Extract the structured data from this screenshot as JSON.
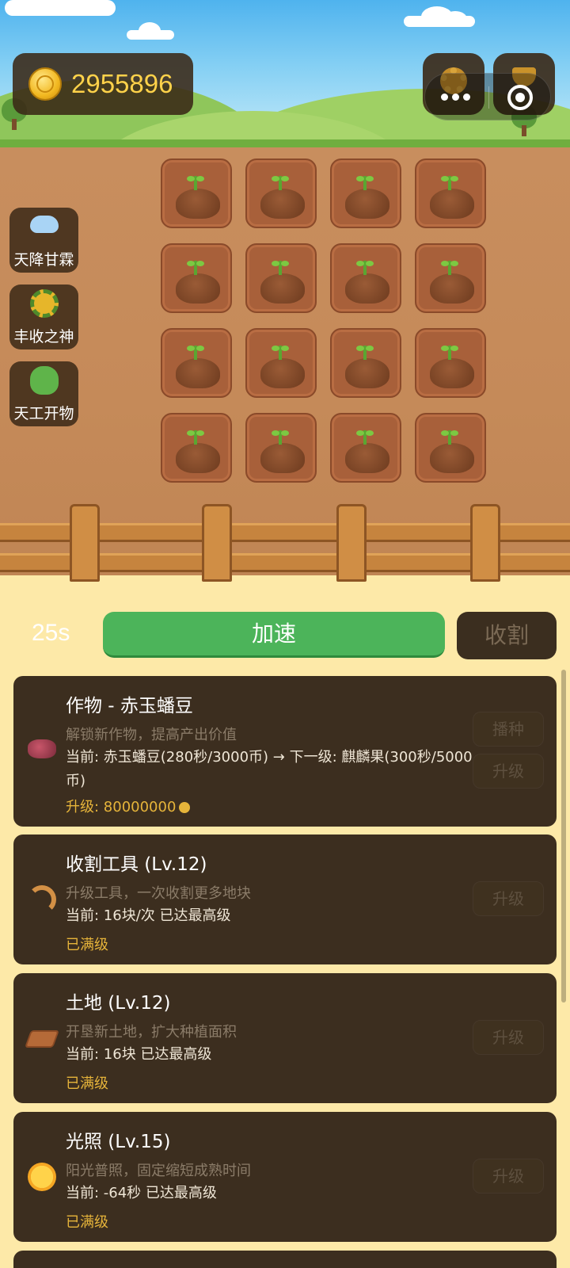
{
  "coins": {
    "value": "2955896"
  },
  "skills": [
    {
      "label": "天降甘霖",
      "icon": "rain-cloud-icon"
    },
    {
      "label": "丰收之神",
      "icon": "wreath-icon"
    },
    {
      "label": "天工开物",
      "icon": "frog-icon"
    }
  ],
  "plots": {
    "count": 16,
    "crop": "sprout"
  },
  "actions": {
    "timer": "25s",
    "speed_label": "加速",
    "harvest_label": "收割"
  },
  "cards": [
    {
      "title": "作物 - 赤玉蟠豆",
      "desc": "解锁新作物，提高产出价值",
      "current": "当前: 赤玉蟠豆(280秒/3000币) → 下一级: 麒麟果(300秒/5000币)",
      "cost": "升级: 80000000",
      "buttons": [
        "播种",
        "升级"
      ],
      "icon": "bean-icon"
    },
    {
      "title": "收割工具 (Lv.12)",
      "desc": "升级工具，一次收割更多地块",
      "current": "当前: 16块/次  已达最高级",
      "cost": "已满级",
      "buttons": [
        "升级"
      ],
      "icon": "sickle-icon"
    },
    {
      "title": "土地 (Lv.12)",
      "desc": "开垦新土地，扩大种植面积",
      "current": "当前: 16块  已达最高级",
      "cost": "已满级",
      "buttons": [
        "升级"
      ],
      "icon": "soil-icon"
    },
    {
      "title": "光照 (Lv.15)",
      "desc": "阳光普照，固定缩短成熟时间",
      "current": "当前: -64秒  已达最高级",
      "cost": "已满级",
      "buttons": [
        "升级"
      ],
      "icon": "sun-icon"
    }
  ],
  "colors": {
    "accent_green": "#4cb45a",
    "gold": "#e6b43a",
    "card_bg": "#3c2e1f",
    "page_bg": "#fde9a8"
  }
}
